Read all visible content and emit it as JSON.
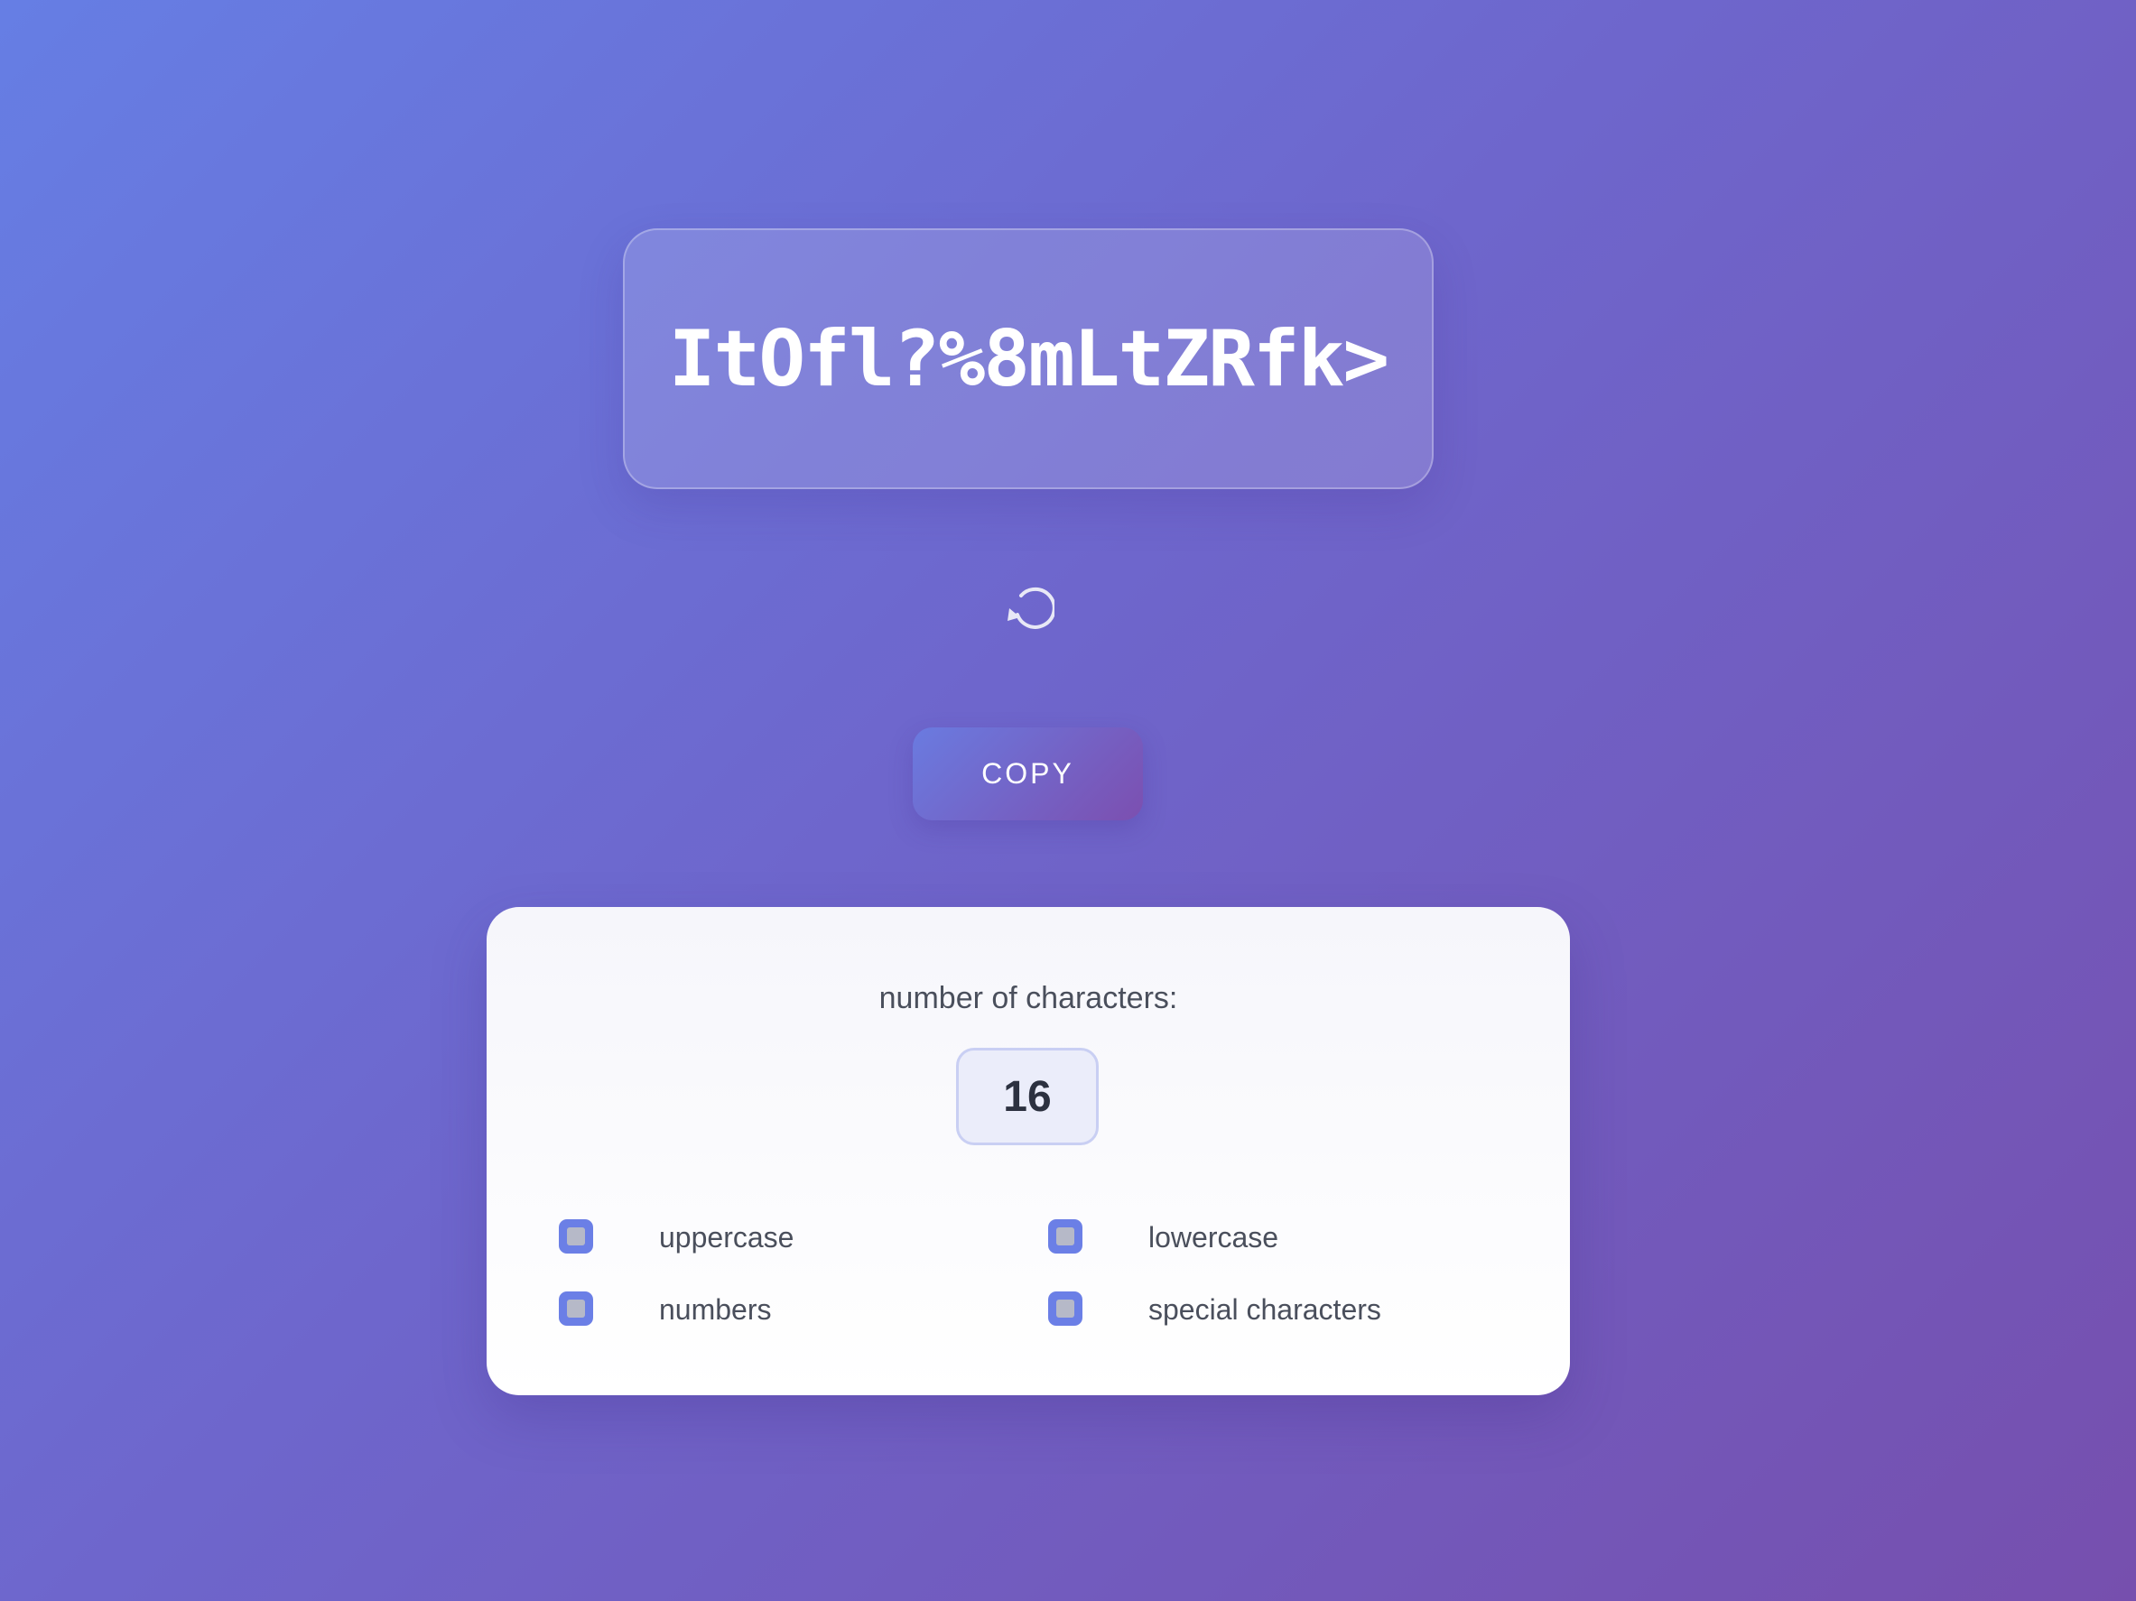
{
  "password": {
    "value": "ItOfl?%8mLtZRfk>"
  },
  "refresh": {
    "icon": "refresh-icon"
  },
  "copy_button": {
    "label": "COPY"
  },
  "settings": {
    "length_label": "number of characters:",
    "length_value": "16",
    "options": {
      "uppercase": {
        "label": "uppercase",
        "checked": false
      },
      "lowercase": {
        "label": "lowercase",
        "checked": false
      },
      "numbers": {
        "label": "numbers",
        "checked": false
      },
      "special": {
        "label": "special characters",
        "checked": false
      }
    }
  },
  "colors": {
    "background_start": "#667ee4",
    "background_end": "#764fae",
    "accent": "#6b7fe6",
    "card": "#f6f6fb",
    "text": "#4a4f5c"
  }
}
